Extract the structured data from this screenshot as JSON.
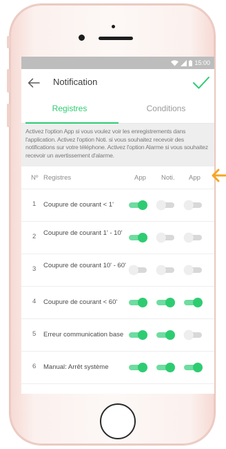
{
  "status_bar": {
    "time": "15:00"
  },
  "app_bar": {
    "title": "Notification"
  },
  "tabs": [
    {
      "label": "Registres",
      "active": true
    },
    {
      "label": "Conditions",
      "active": false
    }
  ],
  "info_text": "Activez l'option App si vous voulez voir les enregistrements dans l'application. Activez l'option Noti. si vous souhaitez recevoir des notifications sur votre téléphone. Activez l'option Alarme si vous souhaitez recevoir un avertissement d'alarme.",
  "table": {
    "headers": {
      "num": "Nº",
      "registres": "Registres",
      "app": "App",
      "noti": "Noti.",
      "alarm": "App"
    },
    "rows": [
      {
        "num": "1",
        "label": "Coupure de courant < 1'",
        "app": true,
        "noti": false,
        "alarm": false
      },
      {
        "num": "2",
        "label": "Coupure de courant 1' - 10'",
        "app": true,
        "noti": false,
        "alarm": false
      },
      {
        "num": "3",
        "label": "Coupure de courant 10' - 60'",
        "app": false,
        "noti": false,
        "alarm": false
      },
      {
        "num": "4",
        "label": "Coupure de courant < 60'",
        "app": true,
        "noti": true,
        "alarm": true
      },
      {
        "num": "5",
        "label": "Erreur communication base",
        "app": true,
        "noti": true,
        "alarm": false
      },
      {
        "num": "6",
        "label": "Manual: Arrêt système",
        "app": true,
        "noti": true,
        "alarm": true
      }
    ]
  },
  "colors": {
    "accent": "#2ecc71",
    "accent_light": "#6fdca0",
    "toggle_off": "#d8d8d8",
    "status_bar": "#bdbdbd",
    "marker": "#f5a623"
  }
}
